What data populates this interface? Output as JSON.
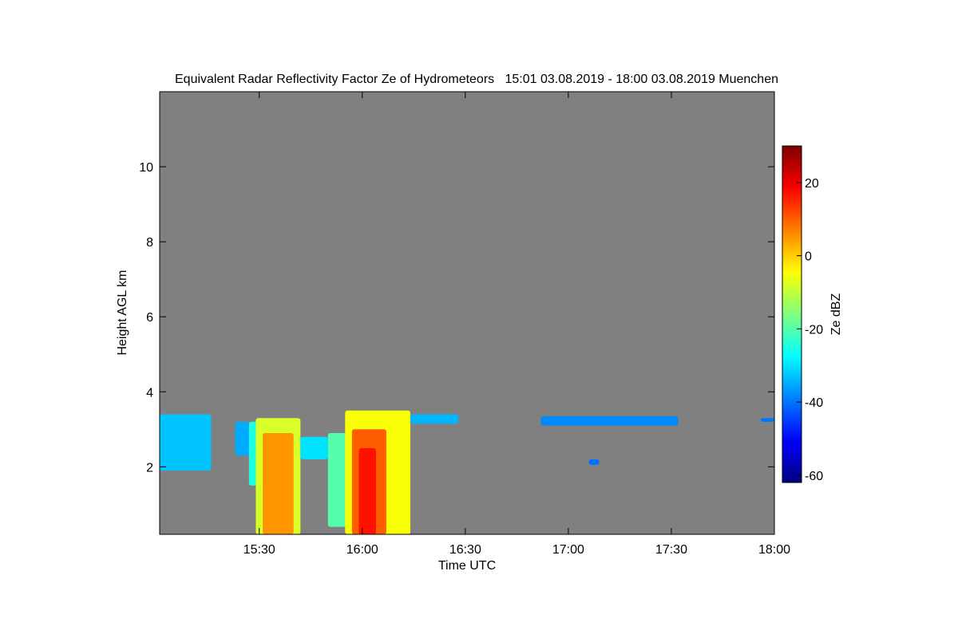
{
  "chart_data": {
    "type": "heatmap",
    "title": "Equivalent Radar Reflectivity Factor Ze of Hydrometeors   15:01 03.08.2019 - 18:00 03.08.2019 Muenchen",
    "xlabel": "Time UTC",
    "ylabel": "Height AGL km",
    "x_ticks": [
      {
        "minutes": 30,
        "label": "15:30"
      },
      {
        "minutes": 60,
        "label": "16:00"
      },
      {
        "minutes": 90,
        "label": "16:30"
      },
      {
        "minutes": 120,
        "label": "17:00"
      },
      {
        "minutes": 150,
        "label": "17:30"
      },
      {
        "minutes": 180,
        "label": "18:00"
      }
    ],
    "xlim_minutes_after_15_00": [
      1,
      180
    ],
    "y_ticks": [
      2,
      4,
      6,
      8,
      10
    ],
    "ylim": [
      0.2,
      12.0
    ],
    "colorbar": {
      "label": "Ze dBZ",
      "range": [
        -62,
        30
      ],
      "ticks": [
        -60,
        -40,
        -20,
        0,
        20
      ],
      "colors": [
        "#00007f",
        "#0000ff",
        "#007fff",
        "#00ffff",
        "#7fff7f",
        "#ffff00",
        "#ff7f00",
        "#ff0000",
        "#7f0000"
      ]
    },
    "background_color": "#808080",
    "regions": [
      {
        "t0": 1,
        "t1": 16,
        "h0": 1.9,
        "h1": 3.4,
        "dbz": -33
      },
      {
        "t0": 23,
        "t1": 27,
        "h0": 2.3,
        "h1": 3.2,
        "dbz": -35
      },
      {
        "t0": 27,
        "t1": 36,
        "h0": 1.5,
        "h1": 3.2,
        "dbz": -25
      },
      {
        "t0": 29,
        "t1": 42,
        "h0": 0.2,
        "h1": 3.3,
        "dbz": -8
      },
      {
        "t0": 31,
        "t1": 40,
        "h0": 0.2,
        "h1": 2.9,
        "dbz": 5
      },
      {
        "t0": 42,
        "t1": 50,
        "h0": 2.2,
        "h1": 2.8,
        "dbz": -30
      },
      {
        "t0": 50,
        "t1": 56,
        "h0": 0.4,
        "h1": 2.9,
        "dbz": -20
      },
      {
        "t0": 55,
        "t1": 74,
        "h0": 0.2,
        "h1": 3.5,
        "dbz": -5
      },
      {
        "t0": 57,
        "t1": 67,
        "h0": 0.2,
        "h1": 3.0,
        "dbz": 10
      },
      {
        "t0": 59,
        "t1": 64,
        "h0": 0.2,
        "h1": 2.5,
        "dbz": 17
      },
      {
        "t0": 74,
        "t1": 88,
        "h0": 3.15,
        "h1": 3.4,
        "dbz": -34
      },
      {
        "t0": 112,
        "t1": 152,
        "h0": 3.1,
        "h1": 3.35,
        "dbz": -38
      },
      {
        "t0": 126,
        "t1": 129,
        "h0": 2.05,
        "h1": 2.2,
        "dbz": -40
      },
      {
        "t0": 176,
        "t1": 180,
        "h0": 3.2,
        "h1": 3.3,
        "dbz": -40
      }
    ]
  }
}
